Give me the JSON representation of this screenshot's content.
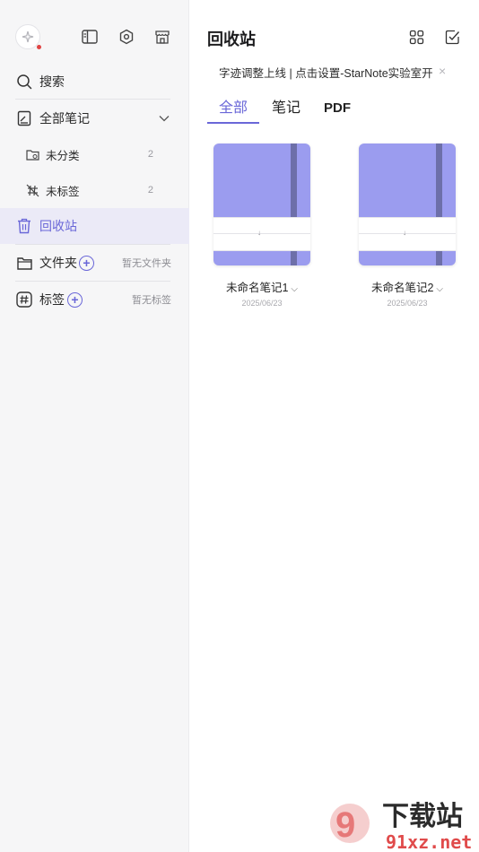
{
  "sidebar": {
    "search_label": "搜索",
    "all_notes_label": "全部笔记",
    "uncategorized_label": "未分类",
    "uncategorized_count": "2",
    "untagged_label": "未标签",
    "untagged_count": "2",
    "trash_label": "回收站",
    "folders_label": "文件夹",
    "folders_hint": "暂无文件夹",
    "tags_label": "标签",
    "tags_hint": "暂无标签"
  },
  "header": {
    "title": "回收站"
  },
  "banner": {
    "text": "字迹调整上线 | 点击设置-StarNote实验室开..."
  },
  "tabs": [
    {
      "label": "全部",
      "active": true
    },
    {
      "label": "笔记",
      "active": false
    },
    {
      "label": "PDF",
      "active": false
    }
  ],
  "notes": [
    {
      "name": "未命名笔记1",
      "date": "2025/06/23"
    },
    {
      "name": "未命名笔记2",
      "date": "2025/06/23"
    }
  ],
  "watermark": {
    "brand": "下载站",
    "domain": "91xz.net"
  },
  "colors": {
    "accent": "#6a67d8",
    "cover": "#9b9cef",
    "strap": "#6d6fa9",
    "sidebar_bg": "#f6f6f7",
    "active_bg": "#ebeaf7"
  }
}
